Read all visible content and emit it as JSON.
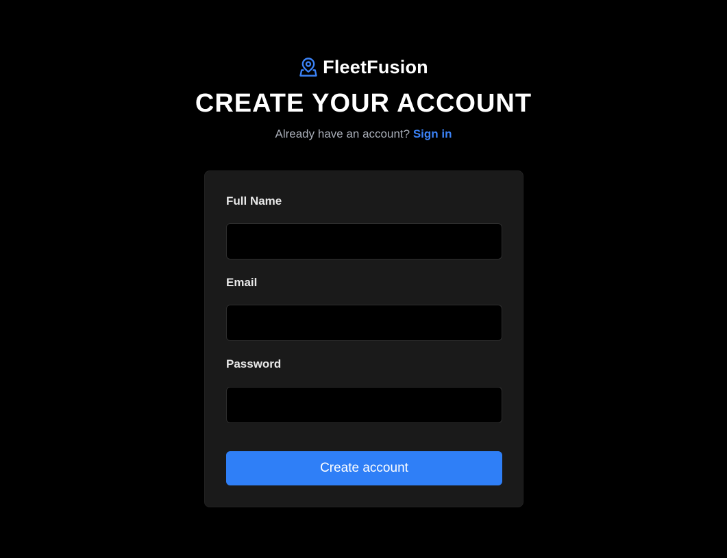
{
  "brand": {
    "name": "FleetFusion",
    "icon": "map-pin-person-icon",
    "icon_color": "#3b82f6"
  },
  "header": {
    "title": "CREATE YOUR ACCOUNT",
    "signin_prompt": "Already have an account?",
    "signin_link": "Sign in"
  },
  "form": {
    "full_name": {
      "label": "Full Name",
      "value": "",
      "placeholder": ""
    },
    "email": {
      "label": "Email",
      "value": "",
      "placeholder": ""
    },
    "password": {
      "label": "Password",
      "value": "",
      "placeholder": ""
    },
    "submit_label": "Create account"
  },
  "colors": {
    "background": "#000000",
    "card": "#1a1a1a",
    "accent": "#2f7ff7",
    "link": "#3b82f6",
    "muted_text": "#a8adb7"
  }
}
